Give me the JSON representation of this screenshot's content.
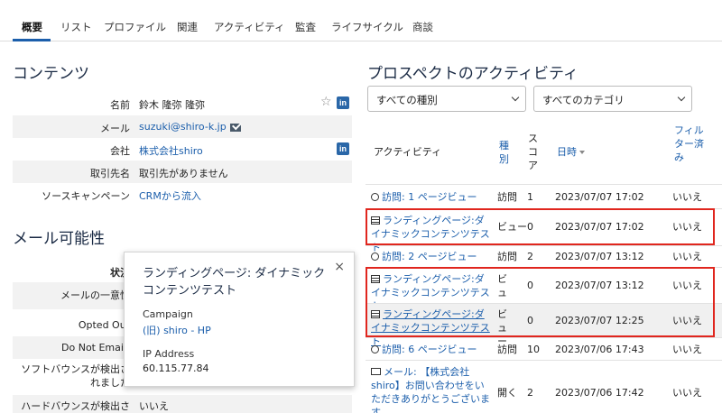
{
  "tabs": [
    "概要",
    "リスト",
    "プロファイル",
    "関連",
    "アクティビティ",
    "監査",
    "ライフサイクル",
    "商談"
  ],
  "content": {
    "title": "コンテンツ",
    "name_label": "名前",
    "name_value": "鈴木 隆弥 隆弥",
    "email_label": "メール",
    "email_value": "suzuki@shiro-k.jp",
    "company_label": "会社",
    "company_value": "株式会社shiro",
    "account_label": "取引先名",
    "account_value": "取引先がありません",
    "campaign_label": "ソースキャンペーン",
    "campaign_value": "CRMから流入",
    "linkedin_badge": "in"
  },
  "mailability": {
    "title": "メール可能性",
    "status_label": "状況",
    "unique_label": "メールの一意性",
    "opted_out_label": "Opted Out",
    "do_not_email_label": "Do Not Email",
    "soft_bounce_label_1": "ソフトバウンスが検出さ",
    "soft_bounce_label_2": "れました",
    "hard_bounce_label": "ハードバウンスが検出さ",
    "hard_bounce_value": "いいえ"
  },
  "popover": {
    "title": "ランディングページ: ダイナミックコンテンツテスト",
    "close": "×",
    "campaign_label": "Campaign",
    "campaign_value": "(旧) shiro - HP",
    "ip_label": "IP Address",
    "ip_value": "60.115.77.84"
  },
  "activities": {
    "title": "プロスペクトのアクティビティ",
    "filter_type": "すべての種別",
    "filter_category": "すべてのカテゴリ",
    "headers": {
      "activity": "アクティビティ",
      "type": "種別",
      "score": "スコア",
      "date": "日時",
      "filtered": "フィルター済み"
    },
    "rows": [
      {
        "icon": "clock",
        "activity": "訪問: 1 ページビュー",
        "type": "訪問",
        "score": "1",
        "date": "2023/07/07 17:02",
        "filtered": "いいえ"
      },
      {
        "icon": "page",
        "activity": "ランディングページ:ダイナミックコンテンツテスト",
        "type": "ビュー",
        "score": "0",
        "date": "2023/07/07 17:02",
        "filtered": "いいえ"
      },
      {
        "icon": "clock",
        "activity": "訪問: 2 ページビュー",
        "type": "訪問",
        "score": "2",
        "date": "2023/07/07 13:12",
        "filtered": "いいえ"
      },
      {
        "icon": "page",
        "activity": "ランディングページ:ダイナミックコンテンツテスト",
        "type": "ビュー",
        "score": "0",
        "date": "2023/07/07 13:12",
        "filtered": "いいえ"
      },
      {
        "icon": "page",
        "activity": "ランディングページ:ダイナミックコンテンツテスト",
        "type": "ビュー",
        "score": "0",
        "date": "2023/07/07 12:25",
        "filtered": "いいえ"
      },
      {
        "icon": "clock",
        "activity": "訪問: 6 ページビュー",
        "type": "訪問",
        "score": "10",
        "date": "2023/07/06 17:43",
        "filtered": "いいえ"
      },
      {
        "icon": "mail",
        "activity": "メール: 【株式会社shiro】お問い合わせをいただきありがとうございます。",
        "type": "開く",
        "score": "2",
        "date": "2023/07/06 17:42",
        "filtered": "いいえ"
      }
    ]
  },
  "colors": {
    "accent": "#1b5eab",
    "highlight": "#e0261e"
  }
}
